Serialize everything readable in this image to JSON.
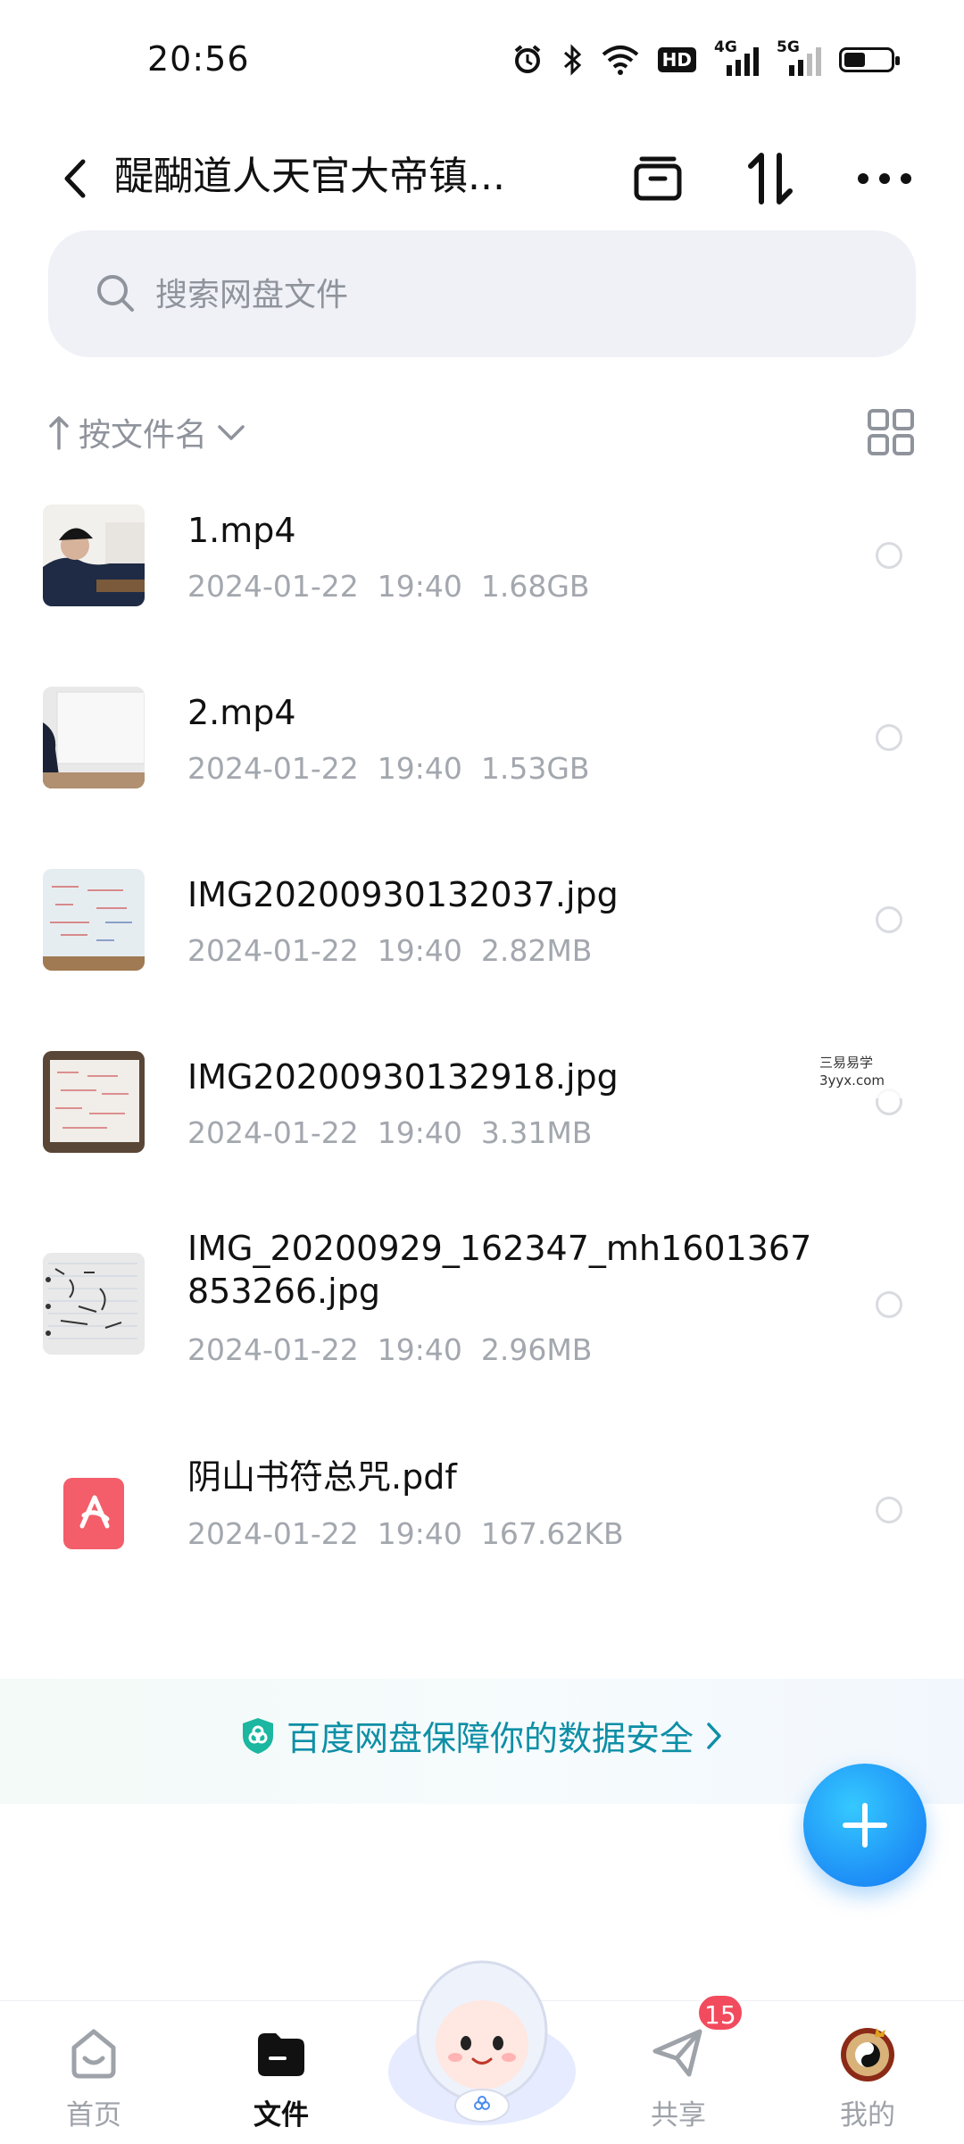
{
  "status_bar": {
    "time": "20:56",
    "icons": [
      "alarm-icon",
      "bluetooth-icon",
      "wifi-icon",
      "hd-icon",
      "signal-4g-icon",
      "signal-5g-icon",
      "battery-icon"
    ],
    "hd_text": "HD",
    "net1": "4G",
    "net2": "5G",
    "battery_level": 0.45
  },
  "header": {
    "title": "醍醐道人天官大帝镇...",
    "icons": [
      "back-icon",
      "archive-icon",
      "transfer-icon",
      "more-icon"
    ]
  },
  "search": {
    "placeholder": "搜索网盘文件"
  },
  "sort": {
    "label": "按文件名"
  },
  "files": [
    {
      "name": "1.mp4",
      "date": "2024-01-22",
      "time": "19:40",
      "size": "1.68GB",
      "thumb": "video-thumbnail"
    },
    {
      "name": "2.mp4",
      "date": "2024-01-22",
      "time": "19:40",
      "size": "1.53GB",
      "thumb": "video-thumbnail"
    },
    {
      "name": "IMG20200930132037.jpg",
      "date": "2024-01-22",
      "time": "19:40",
      "size": "2.82MB",
      "thumb": "image-thumbnail"
    },
    {
      "name": "IMG20200930132918.jpg",
      "date": "2024-01-22",
      "time": "19:40",
      "size": "3.31MB",
      "thumb": "image-thumbnail"
    },
    {
      "name": "IMG_20200929_162347_mh1601367853266.jpg",
      "date": "2024-01-22",
      "time": "19:40",
      "size": "2.96MB",
      "thumb": "image-thumbnail"
    },
    {
      "name": "阴山书符总咒.pdf",
      "date": "2024-01-22",
      "time": "19:40",
      "size": "167.62KB",
      "thumb": "pdf-icon"
    }
  ],
  "watermark": {
    "line1": "三易易学",
    "line2": "3yyx.com"
  },
  "safety_banner": {
    "text": "百度网盘保障你的数据安全"
  },
  "bottom_nav": {
    "items": [
      {
        "label": "首页",
        "icon": "home-icon"
      },
      {
        "label": "文件",
        "icon": "folder-icon"
      },
      {
        "label": "共享",
        "icon": "share-icon"
      },
      {
        "label": "我的",
        "icon": "profile-icon"
      }
    ],
    "share_badge": "15"
  },
  "colors": {
    "accent": "#1a86f5",
    "safety_text": "#0e8fa6",
    "secondary_text": "#a3a7ae",
    "badge": "#f24b5e"
  }
}
